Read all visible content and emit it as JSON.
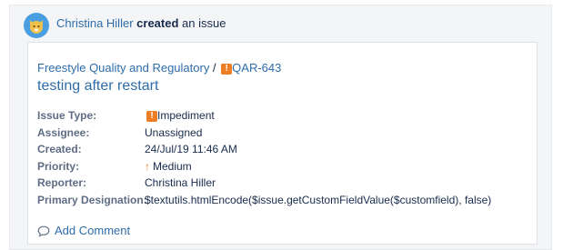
{
  "activity": {
    "actor": "Christina Hiller",
    "verb": "created",
    "object_text": " an issue",
    "avatar_icon": "cat-avatar-icon"
  },
  "issue": {
    "project": "Freestyle Quality and Regulatory",
    "separator": " / ",
    "key": "QAR-643",
    "title": "testing after restart",
    "type_icon_glyph": "!"
  },
  "fields": {
    "issue_type": {
      "label": "Issue Type:",
      "value": "Impediment"
    },
    "assignee": {
      "label": "Assignee:",
      "value": "Unassigned"
    },
    "created": {
      "label": "Created:",
      "value": "24/Jul/19 11:46 AM"
    },
    "priority": {
      "label": "Priority:",
      "value": "Medium",
      "arrow": "↑"
    },
    "reporter": {
      "label": "Reporter:",
      "value": "Christina Hiller"
    },
    "primary_designation": {
      "label": "Primary Designation:",
      "value": "$textutils.htmlEncode($issue.getCustomFieldValue($customfield), false)"
    }
  },
  "actions": {
    "add_comment": "Add Comment"
  },
  "colors": {
    "link": "#2e6ca9",
    "issue_type_icon": "#ee7e24",
    "priority_medium": "#ee7e24"
  }
}
